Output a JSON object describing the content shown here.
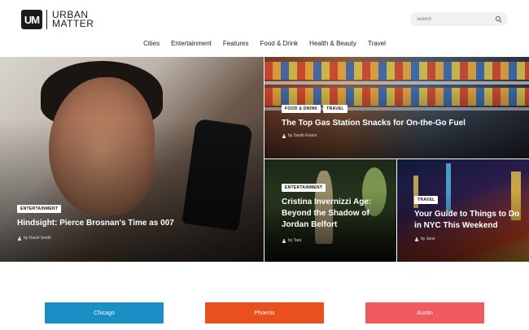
{
  "brand": {
    "mark": "UM",
    "line1": "URBAN",
    "line2": "MATTER"
  },
  "search": {
    "placeholder": "search"
  },
  "nav": [
    "Cities",
    "Entertainment",
    "Features",
    "Food & Drink",
    "Health & Beauty",
    "Travel"
  ],
  "articles": {
    "main": {
      "tags": [
        "ENTERTAINMENT"
      ],
      "title": "Hindsight: Pierce Brosnan's Time as 007",
      "author": "by David Smith"
    },
    "top": {
      "tags": [
        "FOOD & DRINK",
        "TRAVEL"
      ],
      "title": "The Top Gas Station Snacks for On-the-Go Fuel",
      "author": "by Sarah Evans"
    },
    "bottom_left": {
      "tags": [
        "ENTERTAINMENT"
      ],
      "title": "Cristina Invernizzi Age: Beyond the Shadow of Jordan Belfort",
      "author": "by Tara"
    },
    "bottom_right": {
      "tags": [
        "TRAVEL"
      ],
      "title": "Your Guide to Things to Do in NYC This Weekend",
      "author": "by Jane"
    }
  },
  "cities": [
    {
      "label": "Chicago",
      "color": "#1a8fc3"
    },
    {
      "label": "Phoenix",
      "color": "#e8501f"
    },
    {
      "label": "Austin",
      "color": "#ef5a5e"
    }
  ]
}
